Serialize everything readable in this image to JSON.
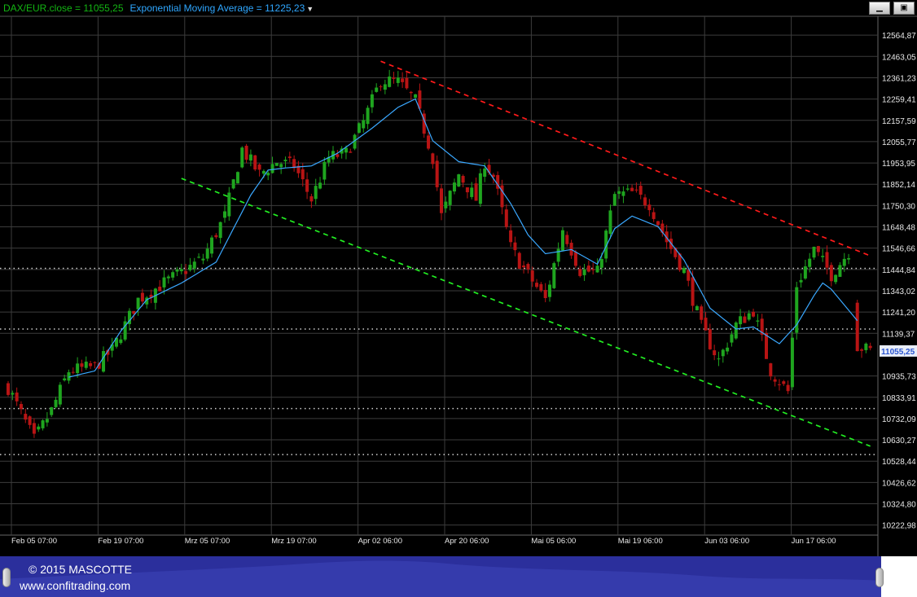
{
  "header": {
    "close_label": "DAX/EUR.close = 11055,25",
    "ema_label": "Exponential Moving Average = 11225,23",
    "dropdown_icon": "triangle-down-icon",
    "minimize_icon": "minimize-icon",
    "restore_icon": "restore-icon"
  },
  "footer": {
    "copyright": "© 2015 MASCOTTE",
    "url": "www.confitrading.com"
  },
  "colors": {
    "up": "#1fa51f",
    "down": "#b81414",
    "ema": "#3aa8ff",
    "resistance": "#ff1a1a",
    "support": "#22ee22",
    "grid": "#3c3c3c",
    "level": "#cfcfcf"
  },
  "chart_data": {
    "type": "candlestick",
    "y_ticks": [
      "12564,87",
      "12463,05",
      "12361,23",
      "12259,41",
      "12157,59",
      "12055,77",
      "11953,95",
      "11852,14",
      "11750,30",
      "11648,48",
      "11546,66",
      "11444,84",
      "11343,02",
      "11241,20",
      "11139,37",
      "10935,73",
      "10833,91",
      "10732,09",
      "10630,27",
      "10528,44",
      "10426,62",
      "10324,80",
      "10222,98"
    ],
    "y_tick_values": [
      12564.87,
      12463.05,
      12361.23,
      12259.41,
      12157.59,
      12055.77,
      11953.95,
      11852.14,
      11750.3,
      11648.48,
      11546.66,
      11444.84,
      11343.02,
      11241.2,
      11139.37,
      10935.73,
      10833.91,
      10732.09,
      10630.27,
      10528.44,
      10426.62,
      10324.8,
      10222.98
    ],
    "ylim": [
      10175,
      12655
    ],
    "current_price_label": "11055,25",
    "current_price": 11055.25,
    "x_ticks": [
      "Feb 05 07:00",
      "Feb 19 07:00",
      "Mrz 05 07:00",
      "Mrz 19 07:00",
      "Apr 02 06:00",
      "Apr 20 06:00",
      "Mai 05 06:00",
      "Mai 19 06:00",
      "Jun 03 06:00",
      "Jun 17 06:00"
    ],
    "x_tick_index": [
      0,
      20,
      40,
      60,
      80,
      100,
      120,
      140,
      160,
      180
    ],
    "n_bars": 200,
    "horizontal_levels": [
      11450,
      11160,
      10780,
      10560
    ],
    "resistance_line": {
      "from": [
        86,
        12440
      ],
      "to": [
        199,
        11510
      ]
    },
    "support_line": {
      "from": [
        40,
        11880
      ],
      "to": [
        199,
        10600
      ]
    },
    "close_anchors": [
      [
        0,
        10880
      ],
      [
        6,
        10630
      ],
      [
        10,
        10770
      ],
      [
        14,
        10960
      ],
      [
        20,
        10980
      ],
      [
        24,
        11060
      ],
      [
        30,
        11300
      ],
      [
        36,
        11380
      ],
      [
        40,
        11430
      ],
      [
        45,
        11500
      ],
      [
        50,
        11700
      ],
      [
        54,
        12020
      ],
      [
        58,
        11900
      ],
      [
        62,
        11960
      ],
      [
        66,
        11940
      ],
      [
        70,
        11780
      ],
      [
        74,
        11980
      ],
      [
        78,
        12000
      ],
      [
        82,
        12150
      ],
      [
        86,
        12350
      ],
      [
        90,
        12340
      ],
      [
        94,
        12250
      ],
      [
        98,
        11980
      ],
      [
        100,
        11700
      ],
      [
        104,
        11900
      ],
      [
        108,
        11780
      ],
      [
        110,
        11960
      ],
      [
        112,
        11890
      ],
      [
        116,
        11550
      ],
      [
        118,
        11480
      ],
      [
        120,
        11420
      ],
      [
        124,
        11300
      ],
      [
        128,
        11640
      ],
      [
        132,
        11440
      ],
      [
        136,
        11430
      ],
      [
        140,
        11800
      ],
      [
        144,
        11810
      ],
      [
        148,
        11760
      ],
      [
        152,
        11580
      ],
      [
        156,
        11440
      ],
      [
        160,
        11170
      ],
      [
        164,
        11010
      ],
      [
        168,
        11180
      ],
      [
        172,
        11250
      ],
      [
        176,
        10960
      ],
      [
        180,
        10860
      ],
      [
        182,
        11370
      ],
      [
        186,
        11540
      ],
      [
        190,
        11420
      ],
      [
        194,
        11530
      ],
      [
        196,
        11080
      ],
      [
        199,
        11055
      ]
    ],
    "ema_anchors": [
      [
        14,
        10930
      ],
      [
        20,
        10960
      ],
      [
        26,
        11150
      ],
      [
        32,
        11300
      ],
      [
        36,
        11340
      ],
      [
        40,
        11380
      ],
      [
        44,
        11430
      ],
      [
        48,
        11480
      ],
      [
        52,
        11640
      ],
      [
        56,
        11800
      ],
      [
        60,
        11920
      ],
      [
        64,
        11930
      ],
      [
        70,
        11940
      ],
      [
        76,
        12000
      ],
      [
        84,
        12120
      ],
      [
        90,
        12220
      ],
      [
        94,
        12260
      ],
      [
        98,
        12060
      ],
      [
        104,
        11960
      ],
      [
        110,
        11940
      ],
      [
        116,
        11760
      ],
      [
        120,
        11610
      ],
      [
        124,
        11520
      ],
      [
        130,
        11540
      ],
      [
        136,
        11470
      ],
      [
        140,
        11640
      ],
      [
        144,
        11700
      ],
      [
        150,
        11650
      ],
      [
        156,
        11490
      ],
      [
        162,
        11260
      ],
      [
        168,
        11160
      ],
      [
        172,
        11170
      ],
      [
        178,
        11090
      ],
      [
        182,
        11180
      ],
      [
        186,
        11320
      ],
      [
        188,
        11380
      ],
      [
        190,
        11350
      ],
      [
        194,
        11250
      ],
      [
        196,
        11200
      ]
    ]
  }
}
